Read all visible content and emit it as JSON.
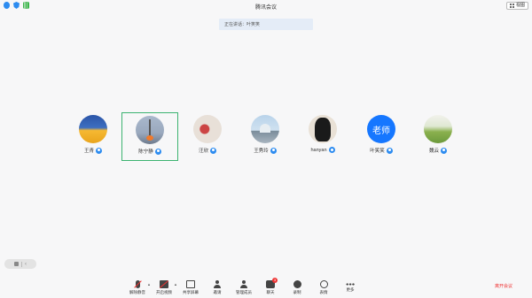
{
  "window": {
    "title": "腾讯会议",
    "view_button_label": "视图"
  },
  "notice": {
    "text": "正在讲话：叶笑笑"
  },
  "participants": [
    {
      "name": "王青",
      "avatar": "sunset-photo"
    },
    {
      "name": "陈宁静",
      "avatar": "tower-photo",
      "active": true
    },
    {
      "name": "汪欣",
      "avatar": "artwork-photo"
    },
    {
      "name": "王秀玲",
      "avatar": "dome-photo"
    },
    {
      "name": "hanyan",
      "avatar": "silhouette-photo"
    },
    {
      "name": "叶笑笑",
      "avatar_text": "老师"
    },
    {
      "name": "魏云",
      "avatar": "path-photo"
    }
  ],
  "toolbar": {
    "items": [
      {
        "label": "解除静音",
        "icon": "microphone-muted-icon",
        "has_caret": true
      },
      {
        "label": "开启视频",
        "icon": "camera-off-icon",
        "has_caret": true
      },
      {
        "label": "共享屏幕",
        "icon": "share-screen-icon"
      },
      {
        "label": "邀请",
        "icon": "invite-icon"
      },
      {
        "label": "管理成员",
        "icon": "manage-members-icon"
      },
      {
        "label": "聊天",
        "icon": "chat-icon",
        "badge": "3"
      },
      {
        "label": "录制",
        "icon": "record-icon"
      },
      {
        "label": "表情",
        "icon": "emoji-icon"
      },
      {
        "label": "更多",
        "icon": "more-icon"
      }
    ],
    "leave_label": "离开会议"
  },
  "colors": {
    "background": "#f7f7f8",
    "accent": "#2d8cf0",
    "active_border": "#3cb371",
    "leave": "#e33333"
  }
}
